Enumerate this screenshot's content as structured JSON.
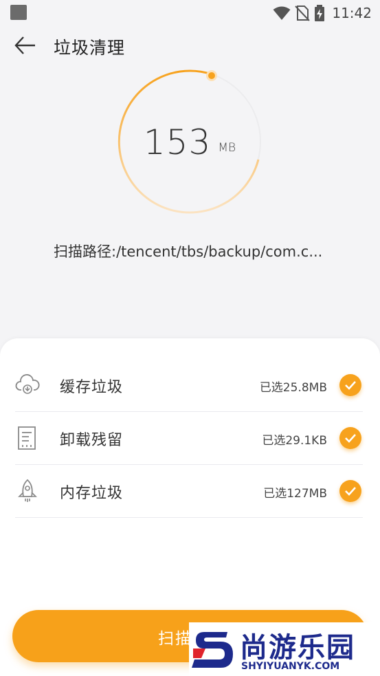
{
  "status_bar": {
    "time": "11:42",
    "icons": [
      "app-notification-icon",
      "wifi-icon",
      "no-sim-icon",
      "battery-charging-icon"
    ]
  },
  "header": {
    "title": "垃圾清理",
    "back_icon": "arrow-left-icon"
  },
  "gauge": {
    "value": "153",
    "unit": "MB",
    "accent_color": "#f7a21d"
  },
  "scan_path": "扫描路径:/tencent/tbs/backup/com.c...",
  "junk_items": [
    {
      "label": "缓存垃圾",
      "size": "已选25.8MB",
      "icon": "cloud-download-icon",
      "checked": true
    },
    {
      "label": "卸载残留",
      "size": "已选29.1KB",
      "icon": "document-icon",
      "checked": true
    },
    {
      "label": "内存垃圾",
      "size": "已选127MB",
      "icon": "rocket-icon",
      "checked": true
    }
  ],
  "scan_button": {
    "label": "扫描"
  },
  "watermark": {
    "text_cn": "尚游乐园",
    "text_en": "SHYIYUANYK.COM"
  },
  "colors": {
    "accent": "#f7a21d",
    "background": "#f4f4f6",
    "card": "#ffffff",
    "watermark_blue": "#1d2a8c",
    "watermark_red": "#e0242c"
  }
}
